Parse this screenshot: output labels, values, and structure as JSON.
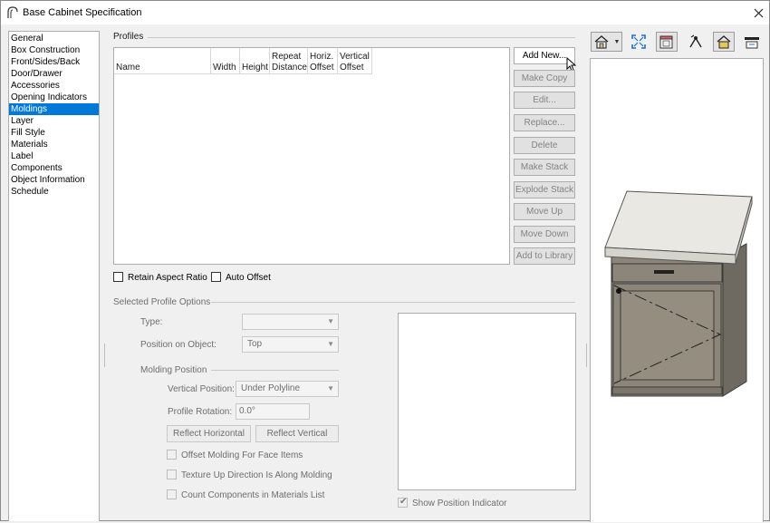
{
  "window": {
    "title": "Base Cabinet Specification"
  },
  "categories": [
    {
      "label": "General",
      "selected": false
    },
    {
      "label": "Box Construction",
      "selected": false
    },
    {
      "label": "Front/Sides/Back",
      "selected": false
    },
    {
      "label": "Door/Drawer",
      "selected": false
    },
    {
      "label": "Accessories",
      "selected": false
    },
    {
      "label": "Opening Indicators",
      "selected": false
    },
    {
      "label": "Moldings",
      "selected": true
    },
    {
      "label": "Layer",
      "selected": false
    },
    {
      "label": "Fill Style",
      "selected": false
    },
    {
      "label": "Materials",
      "selected": false
    },
    {
      "label": "Label",
      "selected": false
    },
    {
      "label": "Components",
      "selected": false
    },
    {
      "label": "Object Information",
      "selected": false
    },
    {
      "label": "Schedule",
      "selected": false
    }
  ],
  "profiles": {
    "group_label": "Profiles",
    "columns": [
      {
        "line1": "",
        "line2": "Name"
      },
      {
        "line1": "",
        "line2": "Width"
      },
      {
        "line1": "",
        "line2": "Height"
      },
      {
        "line1": "Repeat",
        "line2": "Distance"
      },
      {
        "line1": "Horiz.",
        "line2": "Offset"
      },
      {
        "line1": "Vertical",
        "line2": "Offset"
      }
    ],
    "rows": []
  },
  "buttons": [
    {
      "label": "Add New...",
      "enabled": true
    },
    {
      "label": "Make Copy",
      "enabled": false
    },
    {
      "label": "Edit...",
      "enabled": false
    },
    {
      "label": "Replace...",
      "enabled": false
    },
    {
      "label": "Delete",
      "enabled": false
    },
    {
      "label": "Make Stack",
      "enabled": false
    },
    {
      "label": "Explode Stack",
      "enabled": false
    },
    {
      "label": "Move Up",
      "enabled": false
    },
    {
      "label": "Move Down",
      "enabled": false
    },
    {
      "label": "Add to Library",
      "enabled": false
    }
  ],
  "options": {
    "retain_aspect_ratio": {
      "label": "Retain Aspect Ratio",
      "checked": false
    },
    "auto_offset": {
      "label": "Auto Offset",
      "checked": false
    }
  },
  "selected_profile": {
    "group_label": "Selected Profile Options",
    "type_label": "Type:",
    "type_value": "",
    "position_label": "Position on Object:",
    "position_value": "Top",
    "molding_position_label": "Molding Position",
    "vertical_position_label": "Vertical Position:",
    "vertical_position_value": "Under Polyline",
    "profile_rotation_label": "Profile Rotation:",
    "profile_rotation_value": "0.0°",
    "reflect_horizontal": "Reflect Horizontal",
    "reflect_vertical": "Reflect Vertical",
    "offset_face_items": {
      "label": "Offset Molding For Face Items",
      "checked": false
    },
    "texture_up": {
      "label": "Texture Up Direction Is Along Molding",
      "checked": false
    },
    "count_components": {
      "label": "Count Components in Materials List",
      "checked": false
    },
    "show_position_indicator": {
      "label": "Show Position Indicator",
      "checked": true
    }
  },
  "toolbar_icons": [
    "view-style-icon",
    "dropdown-arrow-icon",
    "fill-window-icon",
    "materials-view-icon",
    "camera-orbit-icon",
    "color-on-icon",
    "section-view-icon"
  ],
  "colors": {
    "selection": "#0078d7",
    "cabinet_body": "#8c8579",
    "countertop": "#e9e8e2"
  }
}
